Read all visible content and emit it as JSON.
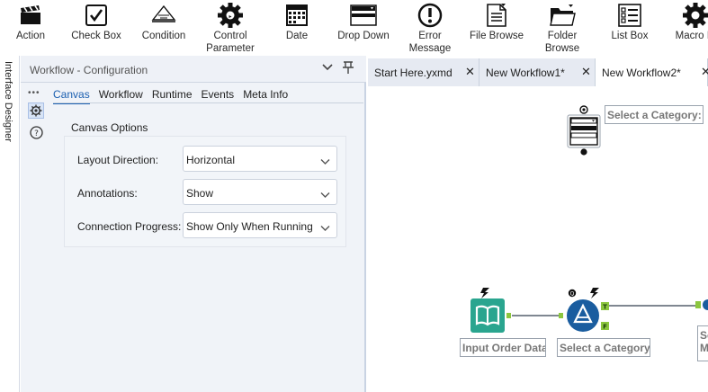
{
  "ribbon": {
    "tools": [
      {
        "label": "Action",
        "icon": "clapperboard-icon"
      },
      {
        "label": "Check Box",
        "icon": "checkbox-icon"
      },
      {
        "label": "Condition",
        "icon": "condition-icon"
      },
      {
        "label": "Control\nParameter",
        "icon": "gear-icon"
      },
      {
        "label": "Date",
        "icon": "calendar-icon"
      },
      {
        "label": "Drop Down",
        "icon": "dropdown-icon"
      },
      {
        "label": "Error\nMessage",
        "icon": "error-icon"
      },
      {
        "label": "File Browse",
        "icon": "file-icon"
      },
      {
        "label": "Folder\nBrowse",
        "icon": "folder-icon"
      },
      {
        "label": "List Box",
        "icon": "listbox-icon"
      },
      {
        "label": "Macro In",
        "icon": "macro-input-icon"
      }
    ]
  },
  "left_strip": {
    "label": "Interface Designer"
  },
  "config": {
    "title": "Workflow - Configuration",
    "tabs": [
      "Canvas",
      "Workflow",
      "Runtime",
      "Events",
      "Meta Info"
    ],
    "active_tab": "Canvas",
    "section": "Canvas Options",
    "rows": [
      {
        "label": "Layout Direction:",
        "value": "Horizontal"
      },
      {
        "label": "Annotations:",
        "value": "Show"
      },
      {
        "label": "Connection Progress:",
        "value": "Show Only When Running"
      }
    ]
  },
  "documents": {
    "tabs": [
      {
        "name": "Start Here.yxmd",
        "active": false
      },
      {
        "name": "New Workflow1*",
        "active": false
      },
      {
        "name": "New Workflow2*",
        "active": true
      }
    ],
    "close_glyph": "✕"
  },
  "canvas": {
    "nodes": [
      {
        "label": "Select a Category:"
      },
      {
        "label": "Input Order Data"
      },
      {
        "label": "Select a Category"
      },
      {
        "label": "Se\nM"
      }
    ],
    "anchor_true": "T",
    "anchor_false": "F",
    "q_badge": "Q"
  },
  "colors": {
    "accent": "#1b5fb0",
    "input_tool": "#2aa58f",
    "filter_tool": "#1a5d9f",
    "anchor": "#8cc63f"
  }
}
